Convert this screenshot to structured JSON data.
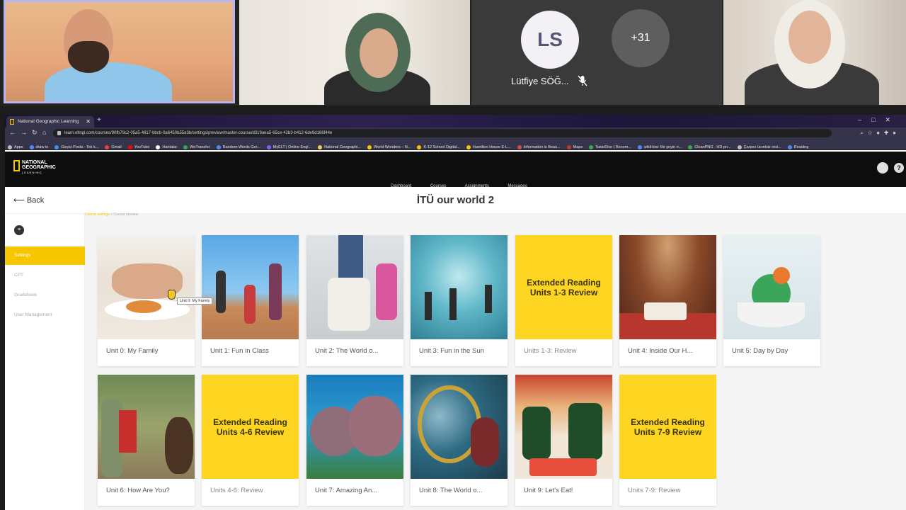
{
  "participants": {
    "ls_initials": "LS",
    "ls_name": "Lütfiye SÖĞ...",
    "more_count": "+31"
  },
  "browser": {
    "tab_title": "National Geographic Learning",
    "url": "learn.eltngl.com/courses/90fb79c2-05a5-4817-bbcb-0a6450b55a3b/settings/preview/master-course/d319aea5-65ce-42b3-b412-6de9d166f44e",
    "bookmarks": [
      "Apps",
      "draw io",
      "Geçici Posta - Tek k...",
      "Gmail",
      "YouTube",
      "Haritalar",
      "WeTransfer",
      "Random Words Ger...",
      "MyELT | Online Engl...",
      "National Geographi...",
      "World Wonders – N...",
      "K-12 School Digital...",
      "Hamilton House E-L...",
      "Information is Beau...",
      "Maps",
      "TasteDive | Recom...",
      "wikiHow: Bir şeyin n...",
      "CleanPNG - HD pn...",
      "Çarpıcı ücretsiz resi...",
      "Reading"
    ]
  },
  "app": {
    "logo_line1": "NATIONAL",
    "logo_line2": "GEOGRAPHIC",
    "logo_sub": "LEARNING",
    "nav": [
      "Dashboard",
      "Courses",
      "Assignments",
      "Messages"
    ]
  },
  "page": {
    "back_label": "Back",
    "title": "İTÜ our world 2",
    "crumb_first": "Course settings",
    "crumb_rest": " > Course preview"
  },
  "sidebar": {
    "items": [
      "Settings",
      "CPT",
      "Gradebook",
      "User Management"
    ]
  },
  "cards": [
    {
      "label": "Unit 0: My Family"
    },
    {
      "label": "Unit 1: Fun in Class"
    },
    {
      "label": "Unit 2: The World o..."
    },
    {
      "label": "Unit 3: Fun in the Sun"
    },
    {
      "label": "Units 1-3: Review",
      "cover": "Extended Reading\nUnits 1-3 Review"
    },
    {
      "label": "Unit 4: Inside Our H..."
    },
    {
      "label": "Unit 5: Day by Day"
    },
    {
      "label": "Unit 6: How Are You?"
    },
    {
      "label": "Units 4-6: Review",
      "cover": "Extended Reading\nUnits 4-6 Review"
    },
    {
      "label": "Unit 7: Amazing An..."
    },
    {
      "label": "Unit 8: The World o..."
    },
    {
      "label": "Unit 9: Let's Eat!"
    },
    {
      "label": "Units 7-9: Review",
      "cover": "Extended Reading\nUnits 7-9 Review"
    }
  ],
  "tooltip": "Unit 0: My Family",
  "colors": {
    "accent": "#f6c700",
    "cover_yellow": "#fed521"
  }
}
